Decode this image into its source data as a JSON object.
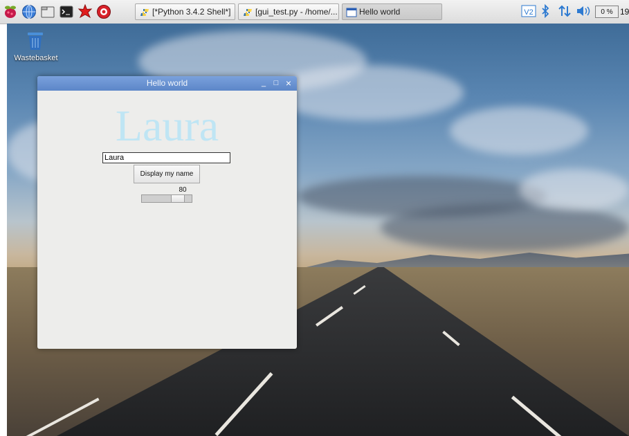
{
  "taskbar": {
    "launchers": [
      "raspberry-menu-icon",
      "web-browser-icon",
      "file-manager-icon",
      "terminal-icon",
      "mathematica-icon",
      "wolfram-icon"
    ],
    "tasks": [
      {
        "label": "[*Python 3.4.2 Shell*]",
        "icon": "python-icon",
        "active": false
      },
      {
        "label": "[gui_test.py - /home/...",
        "icon": "python-icon",
        "active": false
      },
      {
        "label": "Hello world",
        "icon": "window-icon",
        "active": true
      }
    ],
    "tray": {
      "vnc_icon": "vnc-icon",
      "bluetooth_icon": "bluetooth-icon",
      "network_icon": "network-icon",
      "volume_icon": "volume-icon",
      "cpu_label": "0 %",
      "clock": "19"
    }
  },
  "desktop": {
    "wastebasket_label": "Wastebasket"
  },
  "window": {
    "title": "Hello world",
    "big_label": "Laura",
    "big_label_color": "#bfe5f4",
    "entry_value": "Laura",
    "button_label": "Display my name",
    "scale_value": "80",
    "scale_level_percent": 80,
    "controls": {
      "minimize": "_",
      "maximize": "□",
      "close": "×"
    }
  },
  "colors": {
    "titlebar": "#6b92d2",
    "window_bg": "#ededeb"
  }
}
